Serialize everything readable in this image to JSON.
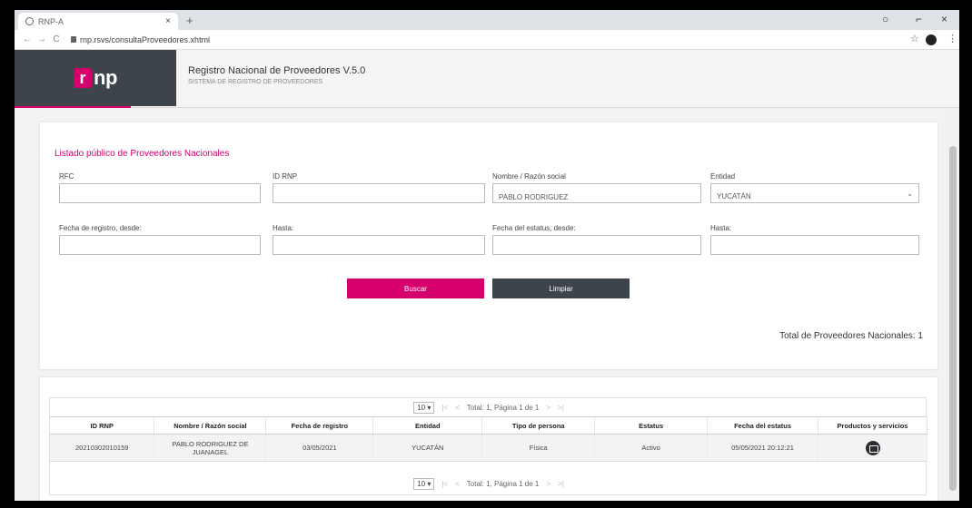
{
  "browser": {
    "tab_title": "RNP-A",
    "url": "rnp.rsvs/consultaProveedores.xhtml",
    "new_tab": "+",
    "tab_close": "×",
    "nav_back": "←",
    "nav_forward": "→",
    "nav_reload": "C",
    "minimize": "○",
    "restore": "⌐",
    "close": "×",
    "star": "☆",
    "menu": "⋮"
  },
  "header": {
    "logo_mark": "r",
    "logo_text": "np",
    "title": "Registro Nacional de Proveedores V.5.0",
    "subtitle": "SISTEMA DE REGISTRO DE PROVEEDORES"
  },
  "filters": {
    "panel_title": "Listado público de Proveedores Nacionales",
    "rfc_label": "RFC",
    "rfc_value": "",
    "id_label": "ID RNP",
    "id_value": "",
    "nombre_label": "Nombre / Razón social",
    "nombre_value": "PABLO RODRIGUEZ",
    "entidad_label": "Entidad",
    "entidad_value": "YUCATÁN",
    "fecha_registro_label": "Fecha de registro, desde:",
    "fecha_registro_value": "",
    "hasta1_label": "Hasta:",
    "hasta1_value": "",
    "fecha_estatus_label": "Fecha del estatus, desde:",
    "fecha_estatus_value": "",
    "hasta2_label": "Hasta:",
    "hasta2_value": "",
    "buscar_label": "Buscar",
    "limpiar_label": "Limpiar",
    "total_label": "Total de Proveedores Nacionales: 1"
  },
  "pager": {
    "page_size": "10",
    "first": "|<",
    "prev": "<",
    "next": ">",
    "last": ">|",
    "summary": "Total: 1, Página 1 de 1"
  },
  "table": {
    "headers": [
      "ID RNP",
      "Nombre / Razón social",
      "Fecha de registro",
      "Entidad",
      "Tipo de persona",
      "Estatus",
      "Fecha del estatus",
      "Productos y servicios"
    ],
    "rows": [
      [
        "20210302010159",
        "PABLO RODRIGUEZ DE JUANAGEL",
        "03/05/2021",
        "YUCATÁN",
        "Física",
        "Activo",
        "05/05/2021 20:12:21",
        ""
      ]
    ]
  },
  "colors": {
    "accent": "#d6006d",
    "dark": "#3d444c"
  }
}
